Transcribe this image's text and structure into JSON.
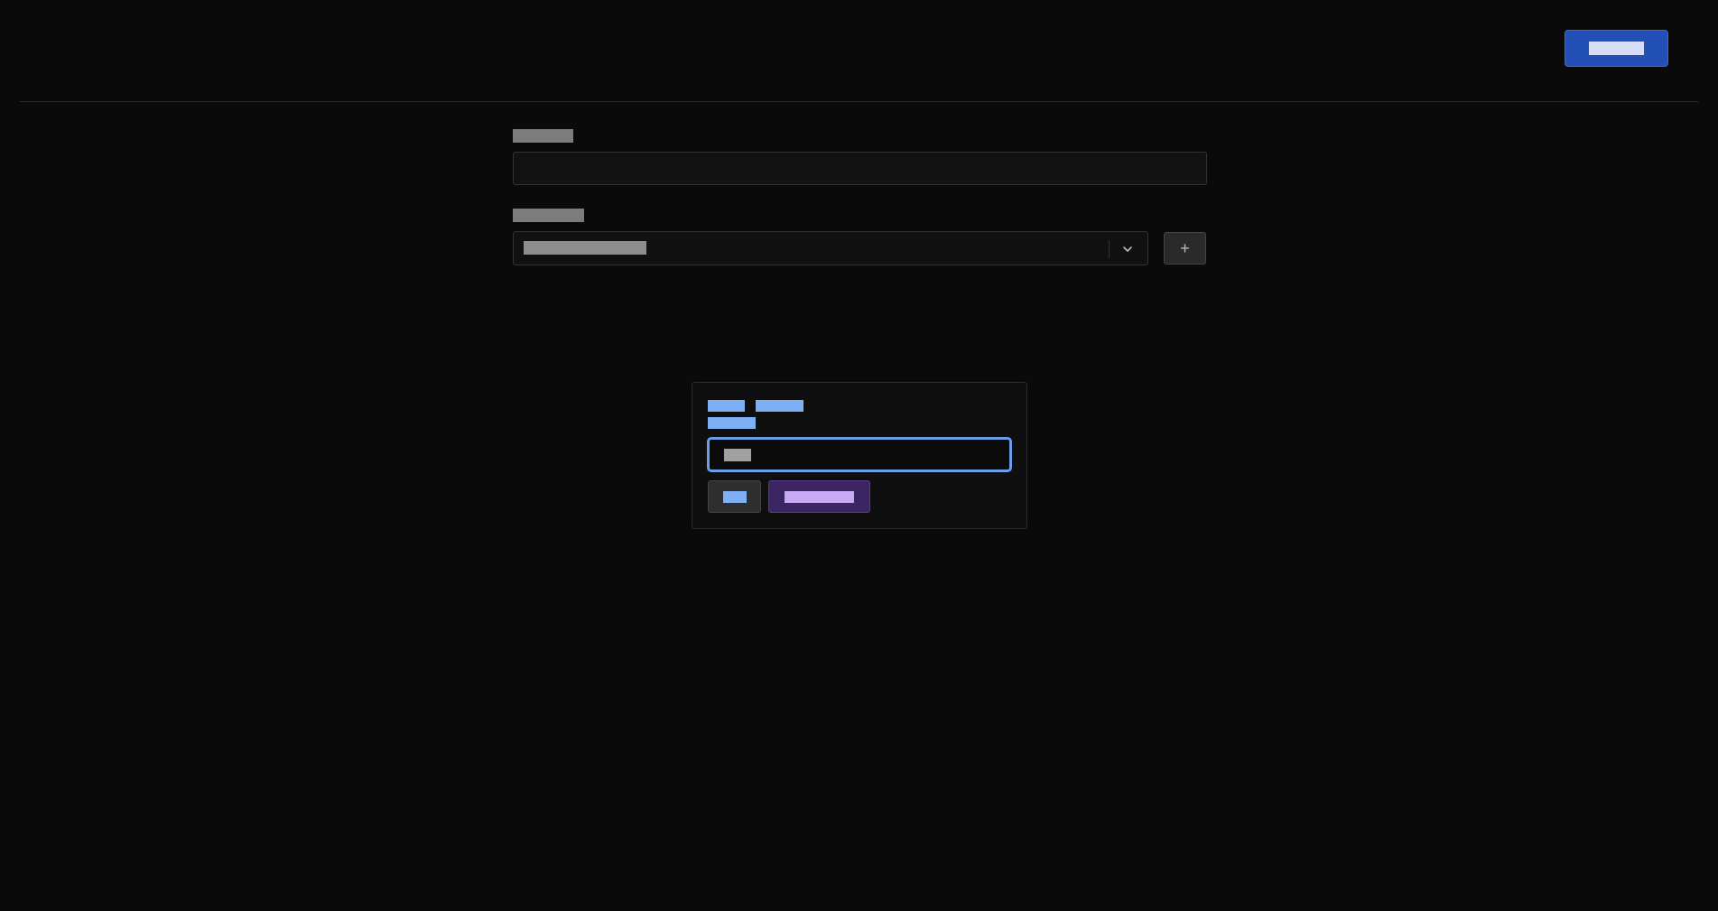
{
  "header": {
    "action_button_label": ""
  },
  "form": {
    "field1_label": "",
    "field1_value": "",
    "field2_label": "",
    "select_value": "",
    "add_button_label": "+"
  },
  "popup": {
    "title_line1_word1": "",
    "title_line1_word2": "",
    "title_line2": "",
    "input_value": "",
    "cancel_label": "",
    "confirm_label": ""
  },
  "icons": {
    "chevron": "chevron-down-icon"
  },
  "colors": {
    "background": "#0a0a0a",
    "primary_button": "#2250b7",
    "focus_ring": "#6b9eea",
    "accent_text": "#7fb0f6",
    "confirm_bg": "#3c2563",
    "confirm_text": "#c9a8f6"
  }
}
